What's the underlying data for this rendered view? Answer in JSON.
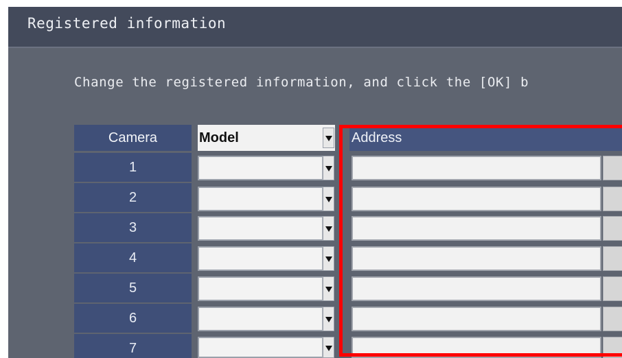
{
  "window": {
    "title": "Registered information"
  },
  "instruction": "Change the registered information, and click the [OK] b",
  "table": {
    "headers": {
      "camera": "Camera",
      "model": "Model",
      "address": "Address"
    },
    "rows": [
      {
        "camera": "1",
        "model": "",
        "address": ""
      },
      {
        "camera": "2",
        "model": "",
        "address": ""
      },
      {
        "camera": "3",
        "model": "",
        "address": ""
      },
      {
        "camera": "4",
        "model": "",
        "address": ""
      },
      {
        "camera": "5",
        "model": "",
        "address": ""
      },
      {
        "camera": "6",
        "model": "",
        "address": ""
      },
      {
        "camera": "7",
        "model": "",
        "address": ""
      }
    ]
  },
  "icons": {
    "dropdown": "dropdown-arrow-icon",
    "address_button": "address-browse-button"
  },
  "colors": {
    "panel_background": "#5e6470",
    "title_bar": "#434a5b",
    "camera_column": "#3f4f78",
    "address_header": "#45557f",
    "highlight": "#ff0000"
  }
}
